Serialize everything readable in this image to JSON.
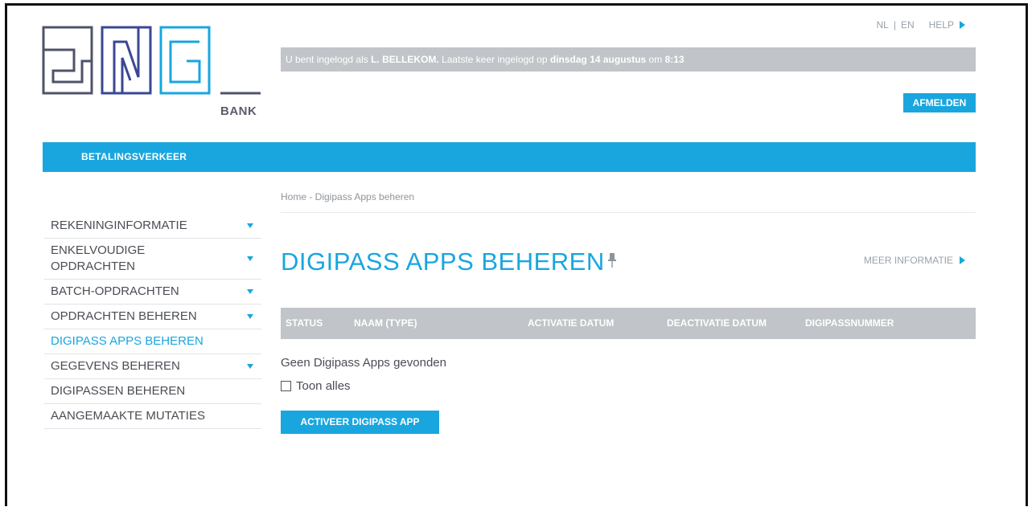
{
  "brand": {
    "logo_text": "BNG",
    "sub_label": "BANK",
    "accent": "#19a6df",
    "logo_dark": "#4f5368",
    "logo_mid": "#3a4796"
  },
  "topnav": {
    "lang_nl": "NL",
    "separator": "|",
    "lang_en": "EN",
    "help": "HELP"
  },
  "login_bar": {
    "prefix": "U bent ingelogd als ",
    "user": "L. BELLEKOM.",
    "middle": " Laatste keer ingelogd op ",
    "date": "dinsdag 14 augustus",
    "time_prefix": " om ",
    "time": "8:13"
  },
  "logout_label": "AFMELDEN",
  "mainnav": {
    "item": "BETALINGSVERKEER"
  },
  "breadcrumb": "Home - Digipass Apps beheren",
  "sidebar": {
    "items": [
      {
        "label": "REKENINGINFORMATIE",
        "has_arrow": true,
        "active": false
      },
      {
        "label": "ENKELVOUDIGE OPDRACHTEN",
        "has_arrow": true,
        "active": false
      },
      {
        "label": "BATCH-OPDRACHTEN",
        "has_arrow": true,
        "active": false
      },
      {
        "label": "OPDRACHTEN BEHEREN",
        "has_arrow": true,
        "active": false
      },
      {
        "label": "DIGIPASS APPS BEHEREN",
        "has_arrow": false,
        "active": true
      },
      {
        "label": "GEGEVENS BEHEREN",
        "has_arrow": true,
        "active": false
      },
      {
        "label": "DIGIPASSEN BEHEREN",
        "has_arrow": false,
        "active": false
      },
      {
        "label": "AANGEMAAKTE MUTATIES",
        "has_arrow": false,
        "active": false
      }
    ]
  },
  "page_title": "DIGIPASS APPS BEHEREN",
  "more_info": "MEER INFORMATIE",
  "table": {
    "headers": [
      "STATUS",
      "NAAM (TYPE)",
      "ACTIVATIE DATUM",
      "DEACTIVATIE DATUM",
      "DIGIPASSNUMMER"
    ]
  },
  "empty_message": "Geen Digipass Apps gevonden",
  "show_all": {
    "label": "Toon alles",
    "checked": false
  },
  "activate_button": "ACTIVEER DIGIPASS APP"
}
